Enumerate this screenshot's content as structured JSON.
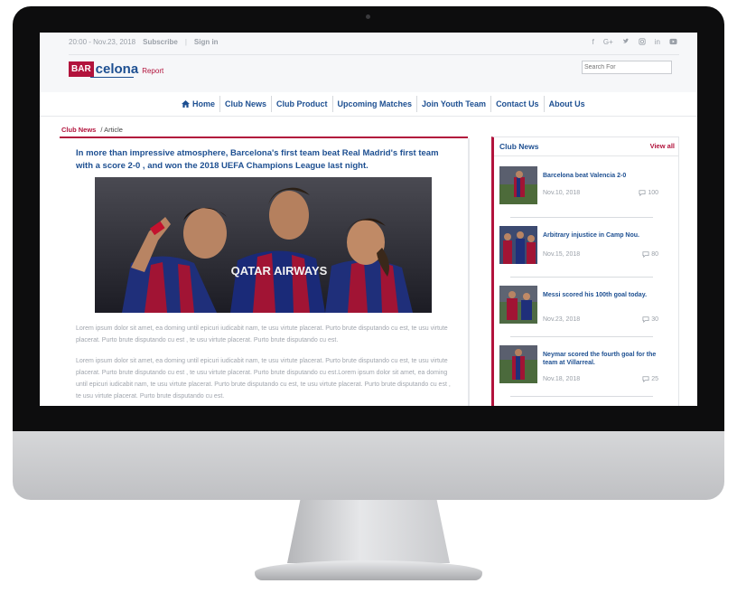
{
  "topbar": {
    "datetime": "20:00 - Nov.23, 2018",
    "subscribe": "Subscribe",
    "separator": "|",
    "signin": "Sign in",
    "social_icons": [
      "facebook-icon",
      "google-plus-icon",
      "twitter-icon",
      "instagram-icon",
      "linkedin-icon",
      "youtube-icon"
    ]
  },
  "logo": {
    "bar": "BAR",
    "name": "celona",
    "report": "Report"
  },
  "search": {
    "placeholder": "Search For"
  },
  "nav": {
    "items": [
      "Home",
      "Club News",
      "Club Product",
      "Upcoming Matches",
      "Join Youth Team",
      "Contact Us",
      "About Us"
    ]
  },
  "breadcrumb": {
    "section": "Club News",
    "page": "/ Article"
  },
  "article": {
    "headline": "In more than impressive atmosphere, Barcelona's first team beat Real Madrid's first team with a score 2-0 , and won the 2018 UEFA Champions League last night.",
    "jersey_text": "QATAR AIRWAYS",
    "para1": "Lorem ipsum dolor sit amet, ea doming until epicuri iudicabit nam, te usu virtute placerat. Purto brute disputando cu est, te usu virtute placerat. Purto brute disputando cu est , te usu virtute placerat. Purto brute disputando cu est.",
    "para2": "Lorem ipsum dolor sit amet, ea doming until epicuri iudicabit nam, te usu virtute placerat. Purto brute disputando cu est, te usu virtute placerat. Purto brute disputando cu est , te usu virtute placerat. Purto brute disputando cu est.Lorem ipsum dolor sit amet, ea doming until epicuri iudicabit nam, te usu virtute placerat. Purto brute disputando cu est, te usu virtute placerat. Purto brute disputando cu est , te usu virtute placerat. Purto brute disputando cu est."
  },
  "sidebar": {
    "title": "Club News",
    "view_all": "View all",
    "items": [
      {
        "title": "Barcelona beat Valencia 2-0",
        "date": "Nov.10, 2018",
        "comments": "100"
      },
      {
        "title": "Arbitrary injustice in Camp Nou.",
        "date": "Nov.15, 2018",
        "comments": "80"
      },
      {
        "title": "Messi scored his 100th goal today.",
        "date": "Nov.23, 2018",
        "comments": "30"
      },
      {
        "title": "Neymar scored the fourth goal for the team at Villarreal.",
        "date": "Nov.18, 2018",
        "comments": "25"
      }
    ]
  },
  "colors": {
    "accent": "#b2133c",
    "brand_blue": "#1d4f91",
    "muted": "#9aa0a8"
  }
}
